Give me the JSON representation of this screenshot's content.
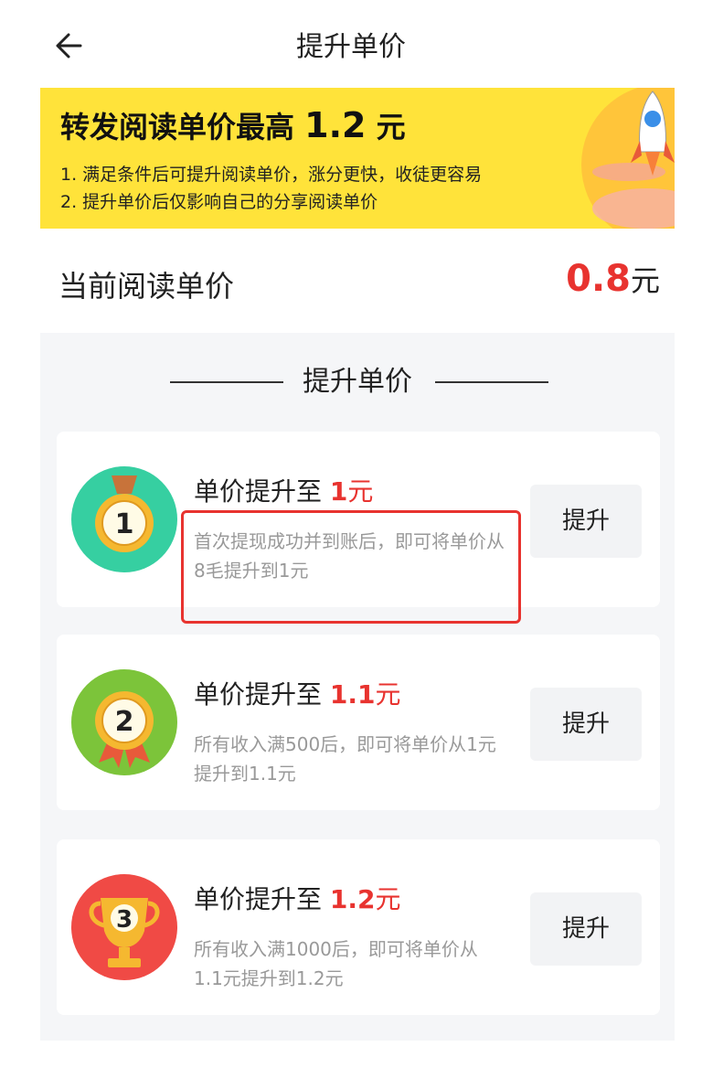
{
  "header": {
    "title": "提升单价"
  },
  "banner": {
    "title_prefix": "转发阅读单价最高",
    "title_value": "1.2",
    "title_unit": "元",
    "line1": "1. 满足条件后可提升阅读单价，涨分更快，收徒更容易",
    "line2": "2. 提升单价后仅影响自己的分享阅读单价"
  },
  "current": {
    "label": "当前阅读单价",
    "value": "0.8",
    "unit": "元"
  },
  "section": {
    "title": "提升单价"
  },
  "levels": [
    {
      "badge": "1",
      "title_prefix": "单价提升至",
      "value": "1",
      "unit": "元",
      "desc": "首次提现成功并到账后，即可将单价从8毛提升到1元",
      "button": "提升",
      "color": "#36cfa1"
    },
    {
      "badge": "2",
      "title_prefix": "单价提升至",
      "value": "1.1",
      "unit": "元",
      "desc": "所有收入满500后，即可将单价从1元提升到1.1元",
      "button": "提升",
      "color": "#7cc43a"
    },
    {
      "badge": "3",
      "title_prefix": "单价提升至",
      "value": "1.2",
      "unit": "元",
      "desc": "所有收入满1000后，即可将单价从1.1元提升到1.2元",
      "button": "提升",
      "color": "#f04a45"
    }
  ],
  "colors": {
    "accent": "#e8332f",
    "banner_bg": "#ffe33a",
    "section_bg": "#f5f6f8",
    "annotation": "#e8332f"
  },
  "icons": {
    "back": "arrow-left-icon",
    "medals": [
      "gold-medal-icon",
      "rosette-medal-icon",
      "trophy-icon"
    ]
  }
}
